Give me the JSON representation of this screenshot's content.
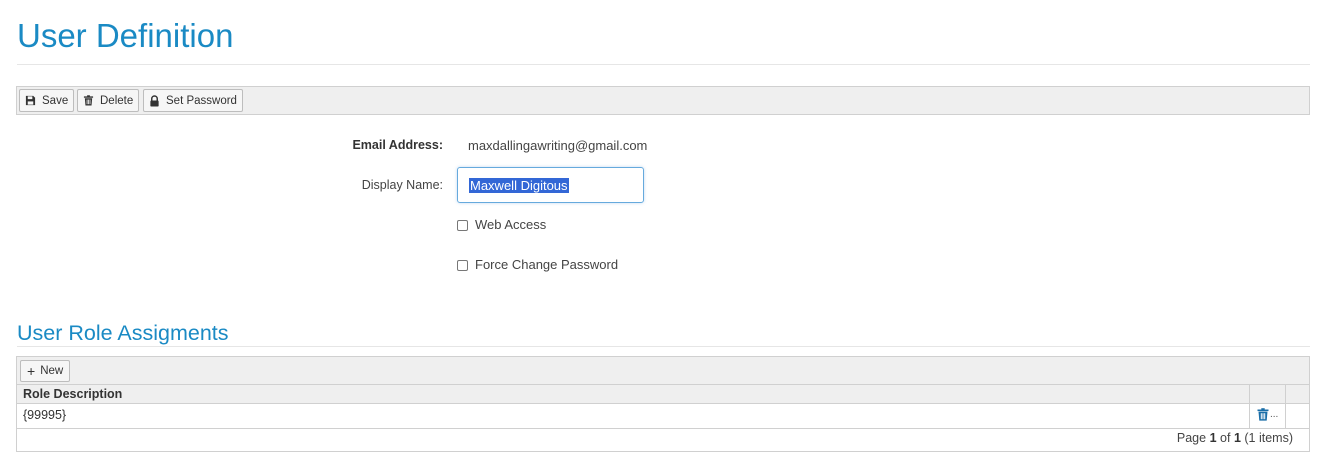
{
  "page": {
    "title": "User Definition"
  },
  "toolbar": {
    "save_label": "Save",
    "delete_label": "Delete",
    "set_password_label": "Set Password"
  },
  "form": {
    "email_label": "Email Address:",
    "email_value": "maxdallingawriting@gmail.com",
    "display_name_label": "Display Name:",
    "display_name_value": "Maxwell Digitous",
    "web_access_label": "Web Access",
    "web_access_checked": false,
    "force_change_label": "Force Change Password",
    "force_change_checked": false
  },
  "roles": {
    "title": "User Role Assigments",
    "new_label": "New",
    "column_header": "Role Description",
    "rows": [
      {
        "role_description": "{99995}"
      }
    ],
    "pager": {
      "prefix": "Page",
      "current": "1",
      "of": "of",
      "total": "1",
      "items": "(1 items)"
    }
  },
  "colors": {
    "accent": "#1a8ac4",
    "selection": "#3367d6",
    "toolbar_bg": "#efefef",
    "delete_icon": "#1a6ea8"
  }
}
